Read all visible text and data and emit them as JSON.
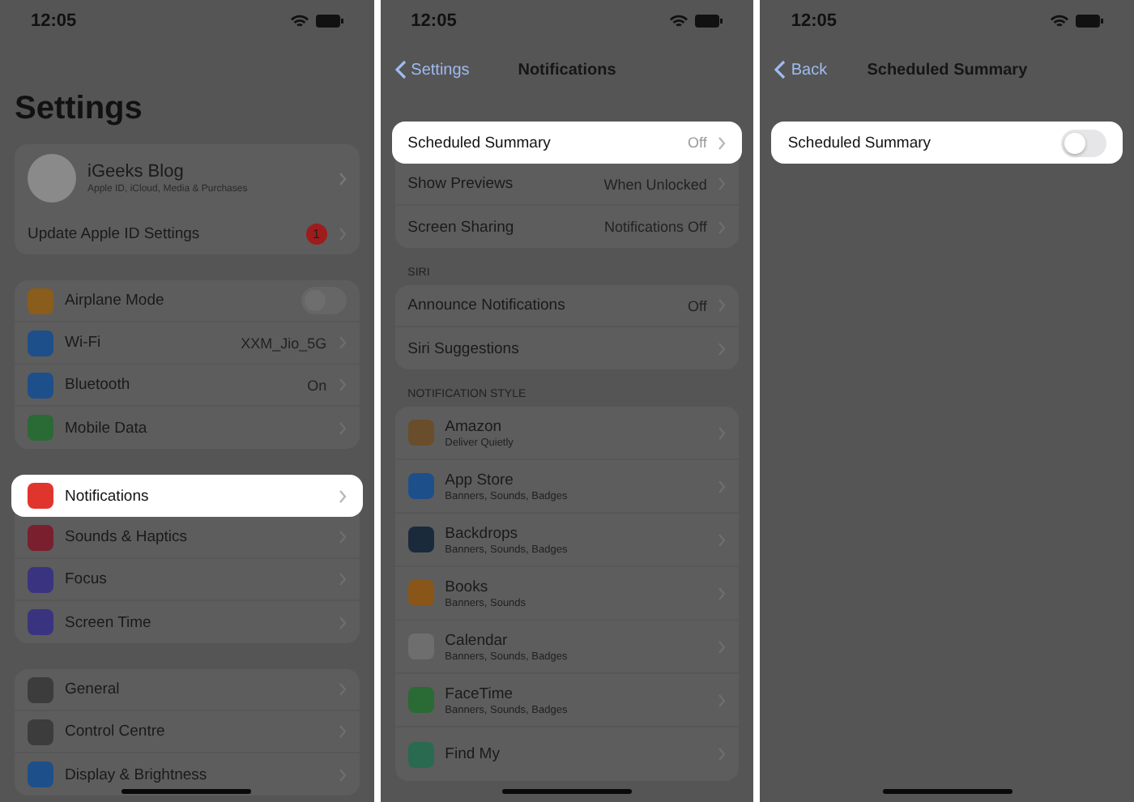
{
  "panels": [
    {
      "time": "12:05",
      "large_title": "Settings",
      "profile": {
        "name": "iGeeks Blog",
        "subtitle": "Apple ID, iCloud, Media & Purchases"
      },
      "sections": [
        {
          "rows": [
            {
              "label": "Update Apple ID Settings",
              "badge": "1",
              "selected": false
            }
          ]
        },
        {
          "rows": [
            {
              "label": "Airplane Mode",
              "color": "#8a5d1c",
              "toggle": false,
              "selected": false
            },
            {
              "label": "Wi-Fi",
              "color": "#1d4f8a",
              "value": "XXM_Jio_5G",
              "selected": false
            },
            {
              "label": "Bluetooth",
              "color": "#1d4f8a",
              "value": "On",
              "selected": false
            },
            {
              "label": "Mobile Data",
              "color": "#2a6a35",
              "selected": false
            }
          ]
        },
        {
          "rows": [
            {
              "label": "Notifications",
              "color": "#e0352d",
              "selected": true
            },
            {
              "label": "Sounds & Haptics",
              "color": "#7a1f2e",
              "selected": false
            },
            {
              "label": "Focus",
              "color": "#3a3480",
              "selected": false
            },
            {
              "label": "Screen Time",
              "color": "#3a3480",
              "selected": false
            }
          ]
        },
        {
          "rows": [
            {
              "label": "General",
              "color": "#3c3c3c",
              "selected": false
            },
            {
              "label": "Control Centre",
              "color": "#3c3c3c",
              "selected": false
            },
            {
              "label": "Display & Brightness",
              "color": "#1d4f8a",
              "selected": false
            }
          ]
        }
      ]
    },
    {
      "time": "12:05",
      "nav": {
        "back": "Settings",
        "title": "Notifications"
      },
      "sections": [
        {
          "rows": [
            {
              "label": "Scheduled Summary",
              "value": "Off",
              "selected": true
            },
            {
              "label": "Show Previews",
              "value": "When Unlocked",
              "selected": false
            },
            {
              "label": "Screen Sharing",
              "value": "Notifications Off",
              "selected": false
            }
          ]
        },
        {
          "header": "SIRI",
          "rows": [
            {
              "label": "Announce Notifications",
              "value": "Off",
              "selected": false
            },
            {
              "label": "Siri Suggestions",
              "selected": false
            }
          ]
        },
        {
          "header": "NOTIFICATION STYLE",
          "rows": [
            {
              "label": "Amazon",
              "subtitle": "Deliver Quietly",
              "color": "#6a4d2a",
              "selected": false
            },
            {
              "label": "App Store",
              "subtitle": "Banners, Sounds, Badges",
              "color": "#1d4f8a",
              "selected": false
            },
            {
              "label": "Backdrops",
              "subtitle": "Banners, Sounds, Badges",
              "color": "#1a2a3a",
              "selected": false
            },
            {
              "label": "Books",
              "subtitle": "Banners, Sounds",
              "color": "#8a5518",
              "selected": false
            },
            {
              "label": "Calendar",
              "subtitle": "Banners, Sounds, Badges",
              "color": "#6e6e6e",
              "selected": false
            },
            {
              "label": "FaceTime",
              "subtitle": "Banners, Sounds, Badges",
              "color": "#2a6a35",
              "selected": false
            },
            {
              "label": "Find My",
              "color": "#2a6a50",
              "selected": false
            }
          ]
        }
      ]
    },
    {
      "time": "12:05",
      "nav": {
        "back": "Back",
        "title": "Scheduled Summary"
      },
      "sections": [
        {
          "rows": [
            {
              "label": "Scheduled Summary",
              "toggle": false,
              "selected": true
            }
          ]
        }
      ]
    }
  ]
}
